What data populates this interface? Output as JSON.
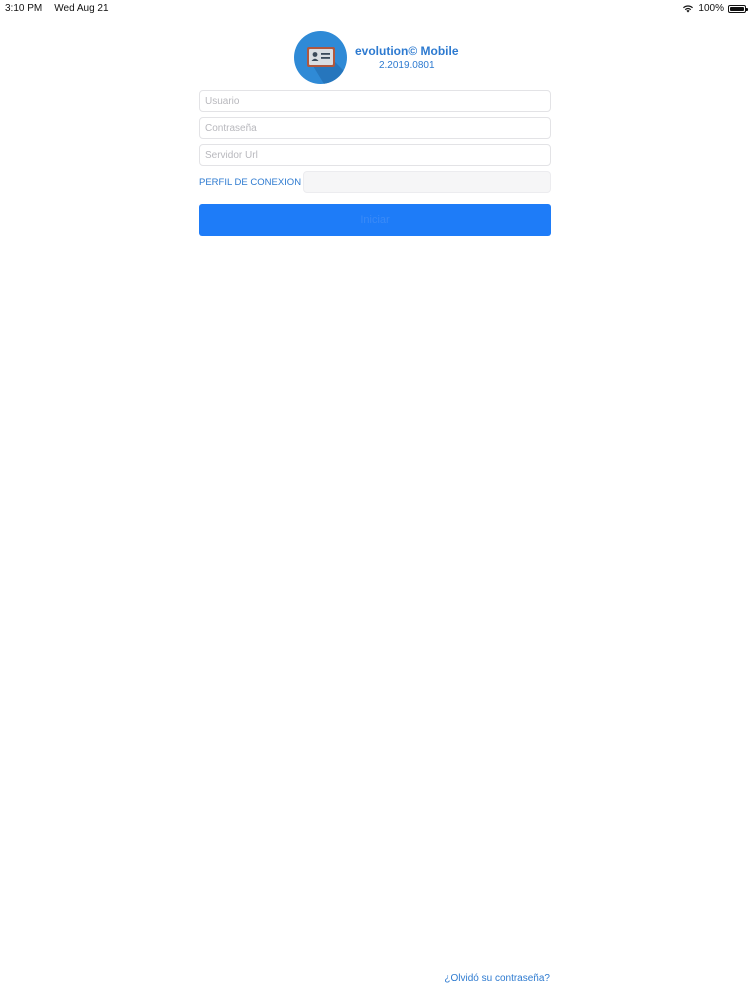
{
  "status_bar": {
    "time": "3:10 PM",
    "date": "Wed Aug 21",
    "battery": "100%",
    "wifi_icon": "wifi-icon",
    "battery_icon": "battery-icon"
  },
  "header": {
    "logo_icon": "id-card-icon",
    "title": "evolution© Mobile",
    "version": "2.2019.0801"
  },
  "form": {
    "username_placeholder": "Usuario",
    "username_value": "",
    "password_placeholder": "Contraseña",
    "password_value": "",
    "server_placeholder": "Servidor Url",
    "server_value": "",
    "profile_label": "PERFIL DE CONEXION",
    "profile_value": "",
    "login_label": "Iniciar"
  },
  "footer": {
    "forgot_password": "¿Olvidó su contraseña?"
  },
  "colors": {
    "accent": "#2d7ad0",
    "button": "#1e7cf8",
    "logo_bg": "#2f8ad6"
  }
}
